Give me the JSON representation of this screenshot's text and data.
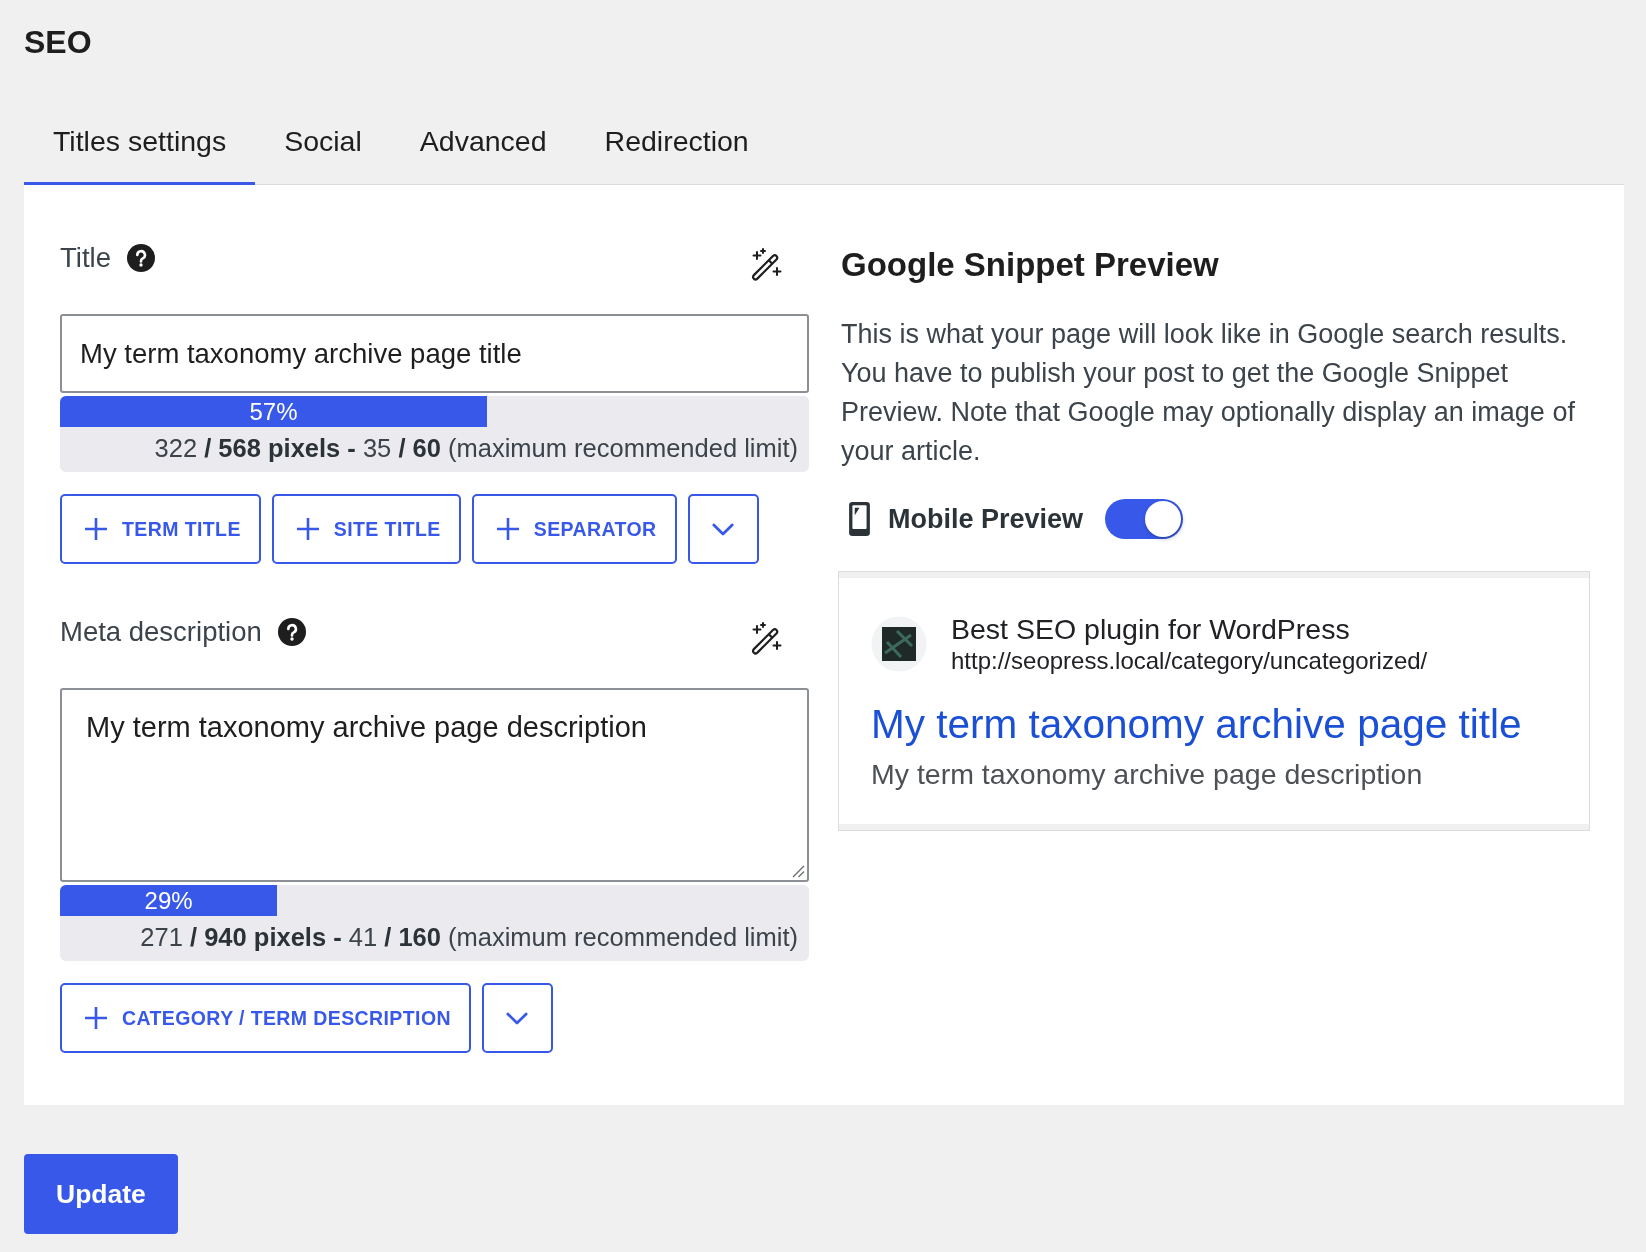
{
  "page_title": "SEO",
  "tabs": [
    {
      "label": "Titles settings",
      "selected": true
    },
    {
      "label": "Social",
      "selected": false
    },
    {
      "label": "Advanced",
      "selected": false
    },
    {
      "label": "Redirection",
      "selected": false
    }
  ],
  "fields": [
    {
      "kind": "input",
      "label": "Title",
      "value": "My term taxonomy archive page title",
      "meter": {
        "level": 0.57,
        "percent": "57%",
        "counter": "322 **/ 568 pixels -** 35 **/ 60** (maximum recommended limit)"
      },
      "buttons": [
        {
          "kind": "add",
          "label": "TERM TITLE"
        },
        {
          "kind": "add",
          "label": "SITE TITLE"
        },
        {
          "kind": "add",
          "label": "SEPARATOR"
        },
        {
          "kind": "menu"
        }
      ]
    },
    {
      "kind": "textarea",
      "label": "Meta description",
      "value": "My term taxonomy archive page description",
      "meter": {
        "level": 0.29,
        "percent": "29%",
        "counter": "271 **/ 940 pixels -** 41 **/ 160** (maximum recommended limit)"
      },
      "buttons": [
        {
          "kind": "add",
          "label": "CATEGORY / TERM DESCRIPTION"
        },
        {
          "kind": "menu"
        }
      ]
    }
  ],
  "snippet_preview": {
    "title": "Google Snippet Preview",
    "description": "This is what your page will look like in Google search results. You have to publish your post to get the Google Snippet Preview. Note that Google may optionally display an image of your article.",
    "mobile_preview": {
      "label": "Mobile Preview",
      "on": true
    },
    "result": {
      "site_name": "Best SEO plugin for WordPress",
      "url": "http://seopress.local/category/uncategorized/",
      "title": "My term taxonomy archive page title",
      "description": "My term taxonomy archive page description"
    }
  },
  "update_button": "Update"
}
